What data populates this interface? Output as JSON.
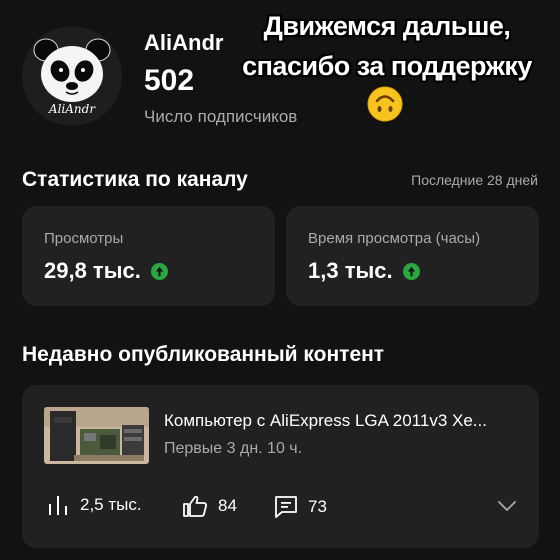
{
  "channel": {
    "name": "AliAndr",
    "avatar_caption": "AliAndr",
    "subscriber_count": "502",
    "subscriber_label": "Число подписчиков"
  },
  "overlay": {
    "line1": "Движемся дальше,",
    "line2": "спасибо за поддержку",
    "emoji": "upside-down-face-emoji"
  },
  "stats": {
    "title": "Статистика по каналу",
    "period": "Последние 28 дней",
    "views": {
      "label": "Просмотры",
      "value": "29,8 тыс.",
      "trend_icon": "arrow-up-icon"
    },
    "watch_time": {
      "label": "Время просмотра (часы)",
      "value": "1,3 тыс.",
      "trend_icon": "arrow-up-icon"
    }
  },
  "recent": {
    "title": "Недавно опубликованный контент",
    "video": {
      "title": "Компьютер с AliExpress LGA 2011v3 Xe...",
      "subtitle": "Первые 3 дн. 10 ч.",
      "views": "2,5 тыс.",
      "likes": "84",
      "comments": "73"
    }
  },
  "colors": {
    "background": "#121212",
    "card": "#212121",
    "secondary_text": "#aaaaaa",
    "trend_up": "#2ba640"
  }
}
